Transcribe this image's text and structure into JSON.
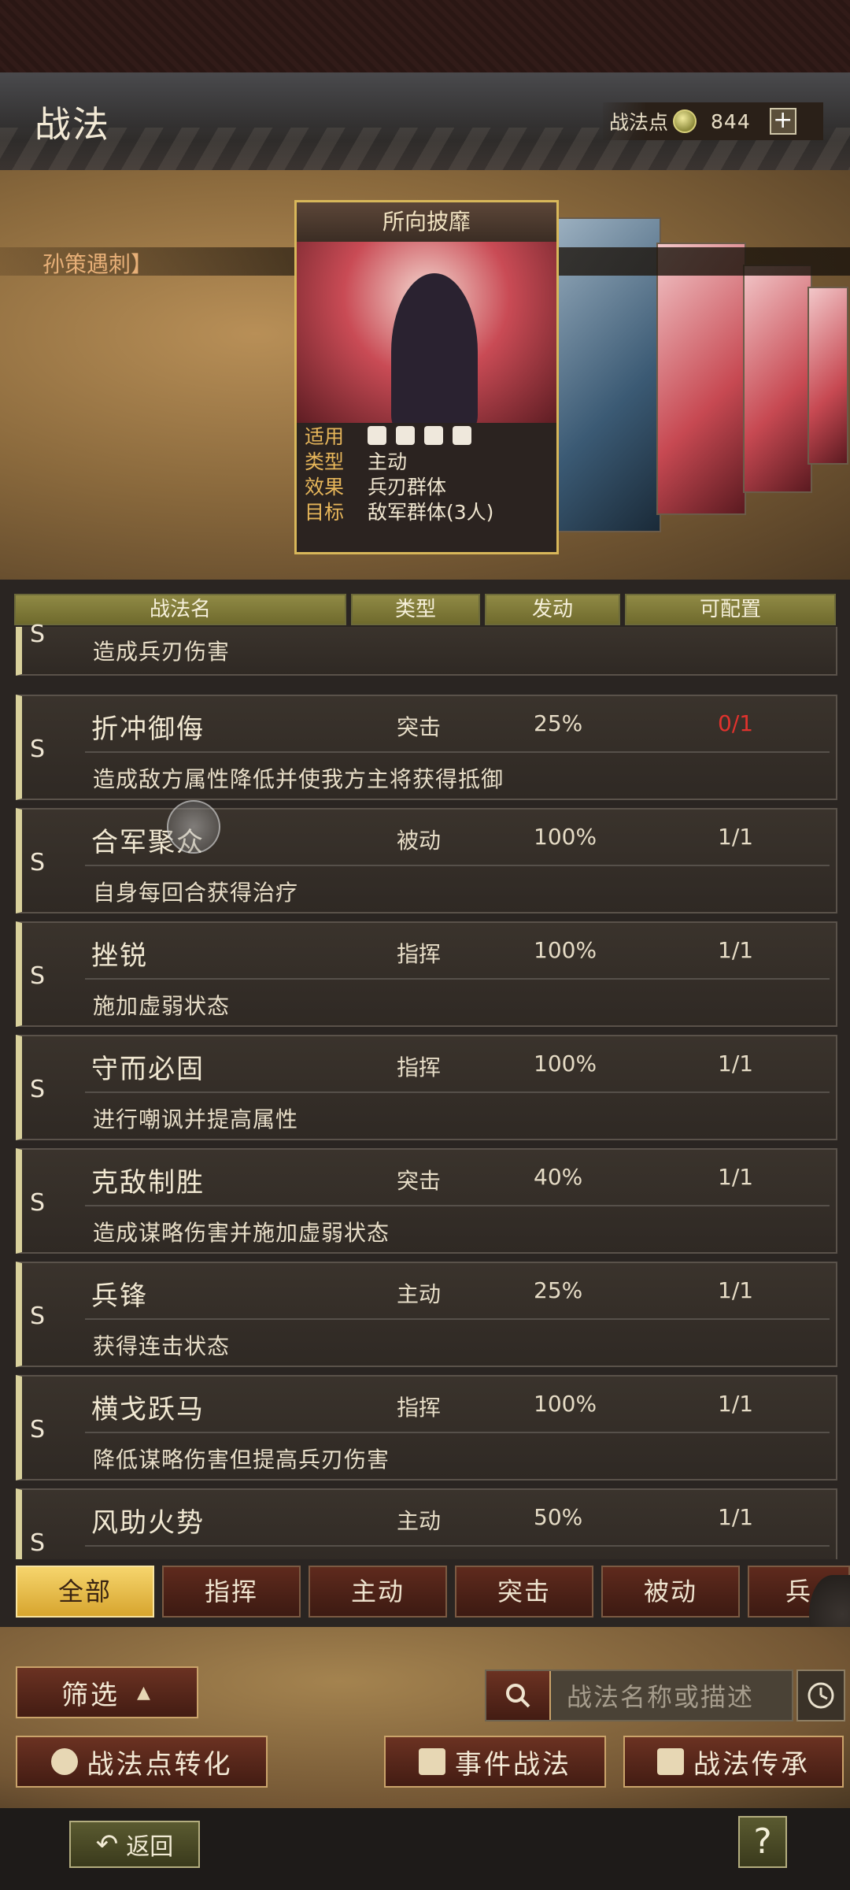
{
  "header": {
    "title": "战法",
    "points_label": "战法点",
    "points_value": "844",
    "plus": "+"
  },
  "banner": {
    "event_text": "孙策遇刺】",
    "card": {
      "title": "所向披靡",
      "rows": [
        {
          "key": "适用",
          "value": ""
        },
        {
          "key": "类型",
          "value": "主动"
        },
        {
          "key": "效果",
          "value": "兵刃群体"
        },
        {
          "key": "目标",
          "value": "敌军群体(3人)"
        }
      ]
    }
  },
  "columns": [
    "战法名",
    "类型",
    "发动",
    "可配置"
  ],
  "partial_row": {
    "grade": "S",
    "desc": "造成兵刃伤害"
  },
  "rows": [
    {
      "grade": "S",
      "name": "折冲御侮",
      "type": "突击",
      "rate": "25%",
      "config": "0/1",
      "config_red": true,
      "desc": "造成敌方属性降低并使我方主将获得抵御"
    },
    {
      "grade": "S",
      "name": "合军聚众",
      "type": "被动",
      "rate": "100%",
      "config": "1/1",
      "desc": "自身每回合获得治疗"
    },
    {
      "grade": "S",
      "name": "挫锐",
      "type": "指挥",
      "rate": "100%",
      "config": "1/1",
      "desc": "施加虚弱状态"
    },
    {
      "grade": "S",
      "name": "守而必固",
      "type": "指挥",
      "rate": "100%",
      "config": "1/1",
      "desc": "进行嘲讽并提高属性"
    },
    {
      "grade": "S",
      "name": "克敌制胜",
      "type": "突击",
      "rate": "40%",
      "config": "1/1",
      "desc": "造成谋略伤害并施加虚弱状态"
    },
    {
      "grade": "S",
      "name": "兵锋",
      "type": "主动",
      "rate": "25%",
      "config": "1/1",
      "desc": "获得连击状态"
    },
    {
      "grade": "S",
      "name": "横戈跃马",
      "type": "指挥",
      "rate": "100%",
      "config": "1/1",
      "desc": "降低谋略伤害但提高兵刃伤害"
    },
    {
      "grade": "S",
      "name": "风助火势",
      "type": "主动",
      "rate": "50%",
      "config": "1/1",
      "desc": ""
    }
  ],
  "tabs": [
    "全部",
    "指挥",
    "主动",
    "突击",
    "被动",
    "兵"
  ],
  "bottom": {
    "filter": "筛选",
    "search_placeholder": "战法名称或描述",
    "convert": "战法点转化",
    "event": "事件战法",
    "inherit": "战法传承"
  },
  "footer": {
    "back": "返回",
    "help": "?"
  }
}
